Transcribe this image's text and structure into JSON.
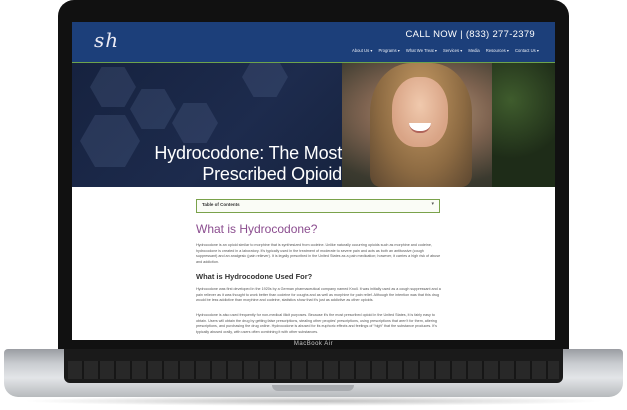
{
  "site": {
    "logo": "sh",
    "call_now": "CALL NOW | (833) 277-2379",
    "nav": [
      "About Us ▾",
      "Programs ▾",
      "What We Treat ▾",
      "Services ▾",
      "Media",
      "Resources ▾",
      "Contact Us ▾"
    ]
  },
  "hero": {
    "title": "Hydrocodone: The Most Prescribed Opioid"
  },
  "toc": {
    "label": "Table of Contents",
    "chevron": "▾"
  },
  "article": {
    "h1": "What is Hydrocodone?",
    "p1": "Hydrocodone is an opioid similar to morphine that is synthesized from codeine. Unlike naturally occurring opioids such as morphine and codeine, hydrocodone is created in a laboratory. It’s typically used in the treatment of moderate to severe pain and acts as both an antitussive (cough suppressant) and an analgesic (pain reliever). It is legally prescribed in the United States as a pain medication; however, it carries a high risk of abuse and addiction.",
    "h2": "What is Hydrocodone Used For?",
    "p2": "Hydrocodone was first developed in the 1920s by a German pharmaceutical company named Knoll. It was initially used as a cough suppressant and a pain reliever as it was thought to work better than codeine for coughs and as well as morphine for pain relief. Although the intention was that this drug would be less addictive than morphine and codeine, statistics show that it’s just as addictive as other opioids.",
    "p3": "Hydrocodone is also used frequently for non-medical illicit purposes. Because it’s the most prescribed opioid in the United States, it is fairly easy to obtain. Users will obtain the drug by getting false prescriptions, stealing other peoples’ prescriptions, using prescriptions that aren’t for them, altering prescriptions, and purchasing the drug online. Hydrocodone is abused for its euphoric effects and feelings of “high” that the substance produces. It’s typically abused orally, with users often combining it with other substances."
  },
  "device": {
    "label": "MacBook Air"
  },
  "colors": {
    "header": "#1c3f7a",
    "accent_green": "#7aa24b",
    "heading_purple": "#8b4d8f"
  }
}
